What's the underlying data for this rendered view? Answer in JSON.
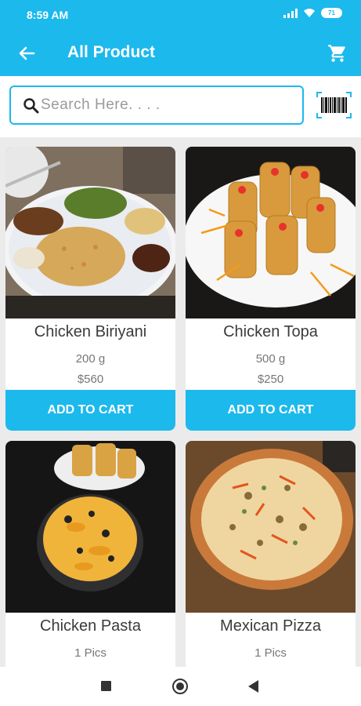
{
  "status_bar": {
    "time": "8:59 AM",
    "battery": "71"
  },
  "app_bar": {
    "title": "All Product"
  },
  "search": {
    "placeholder": "Search Here. . . ."
  },
  "products": [
    {
      "name": "Chicken Biriyani",
      "quantity": "200 g",
      "price": "$560",
      "button": "ADD TO CART"
    },
    {
      "name": "Chicken Topa",
      "quantity": "500 g",
      "price": "$250",
      "button": "ADD TO CART"
    },
    {
      "name": "Chicken Pasta",
      "quantity": "1 Pics",
      "price": "",
      "button": ""
    },
    {
      "name": "Mexican Pizza",
      "quantity": "1 Pics",
      "price": "",
      "button": ""
    }
  ],
  "colors": {
    "primary": "#1cb9ec"
  },
  "icons": [
    "back-arrow-icon",
    "cart-icon",
    "search-icon",
    "barcode-icon"
  ]
}
